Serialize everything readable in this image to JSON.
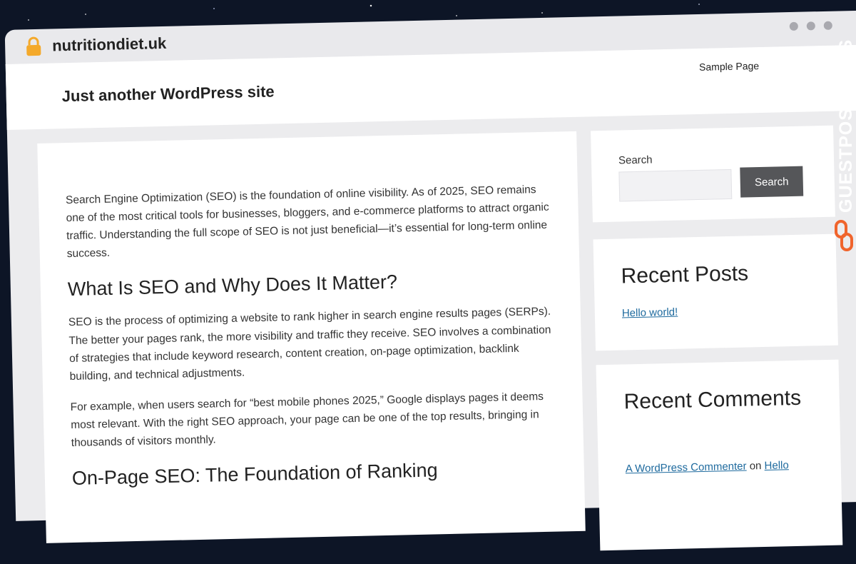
{
  "browser": {
    "url": "nutritiondiet.uk",
    "lock_icon": "lock-icon",
    "window_controls": [
      "dot",
      "dot",
      "dot"
    ]
  },
  "site": {
    "title": "Just another WordPress site",
    "nav": {
      "sample_page": "Sample Page"
    }
  },
  "article": {
    "intro": "Search Engine Optimization (SEO) is the foundation of online visibility. As of 2025, SEO remains one of the most critical tools for businesses, bloggers, and e-commerce platforms to attract organic traffic. Understanding the full scope of SEO is not just beneficial—it’s essential for long-term online success.",
    "heading1": "What Is SEO and Why Does It Matter?",
    "para1": "SEO is the process of optimizing a website to rank higher in search engine results pages (SERPs). The better your pages rank, the more visibility and traffic they receive. SEO involves a combination of strategies that include keyword research, content creation, on-page optimization, backlink building, and technical adjustments.",
    "para2": "For example, when users search for “best mobile phones 2025,” Google displays pages it deems most relevant. With the right SEO approach, your page can be one of the top results, bringing in thousands of visitors monthly.",
    "heading2": "On-Page SEO: The Foundation of Ranking"
  },
  "sidebar": {
    "search": {
      "label": "Search",
      "placeholder": "",
      "button": "Search"
    },
    "recent_posts": {
      "title": "Recent Posts",
      "items": [
        "Hello world!"
      ]
    },
    "recent_comments": {
      "title": "Recent Comments",
      "items": [
        {
          "author": "A WordPress Commenter",
          "connector": "on",
          "post": "Hello"
        }
      ]
    }
  },
  "watermark": {
    "text": "GUESTPOSTLINKS",
    "icon": "chain-link-icon"
  },
  "colors": {
    "link": "#1e6a9e",
    "button": "#555659",
    "watermark_icon": "#f0642c",
    "background": "#0d1526"
  }
}
